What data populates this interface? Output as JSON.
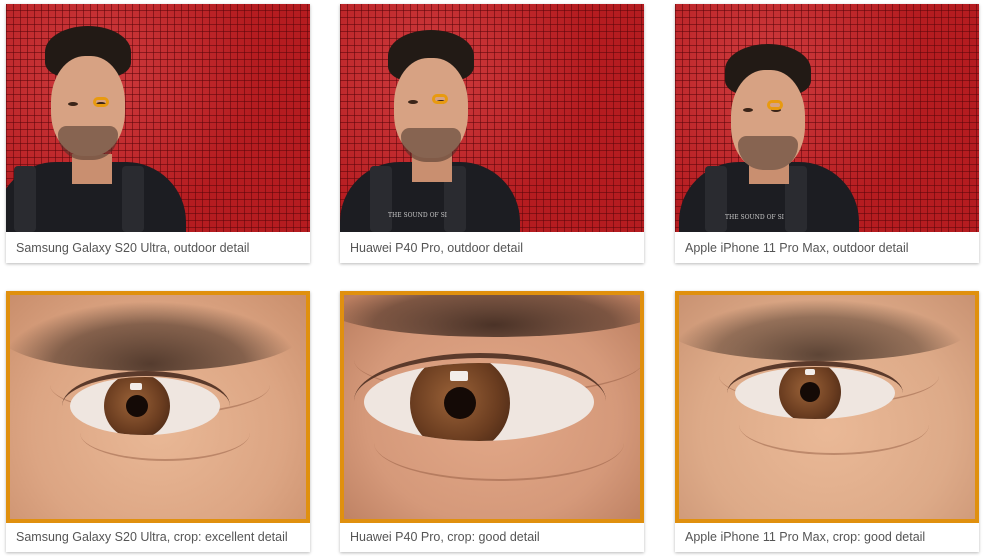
{
  "gallery": {
    "row1": [
      {
        "caption": "Samsung Galaxy S20 Ultra, outdoor detail"
      },
      {
        "caption": "Huawei P40 Pro, outdoor detail",
        "shirt_text": "THE SOUND OF SI"
      },
      {
        "caption": "Apple iPhone 11 Pro Max, outdoor detail",
        "shirt_text": "THE SOUND OF SI"
      }
    ],
    "row2": [
      {
        "caption": "Samsung Galaxy S20 Ultra, crop: excellent detail"
      },
      {
        "caption": "Huawei P40 Pro, crop: good detail"
      },
      {
        "caption": "Apple iPhone 11 Pro Max, crop: good detail"
      }
    ]
  },
  "colors": {
    "crop_frame": "#e0900e",
    "marker": "#e89a10",
    "tile_red": "#b51c20",
    "caption_text": "#555555"
  }
}
